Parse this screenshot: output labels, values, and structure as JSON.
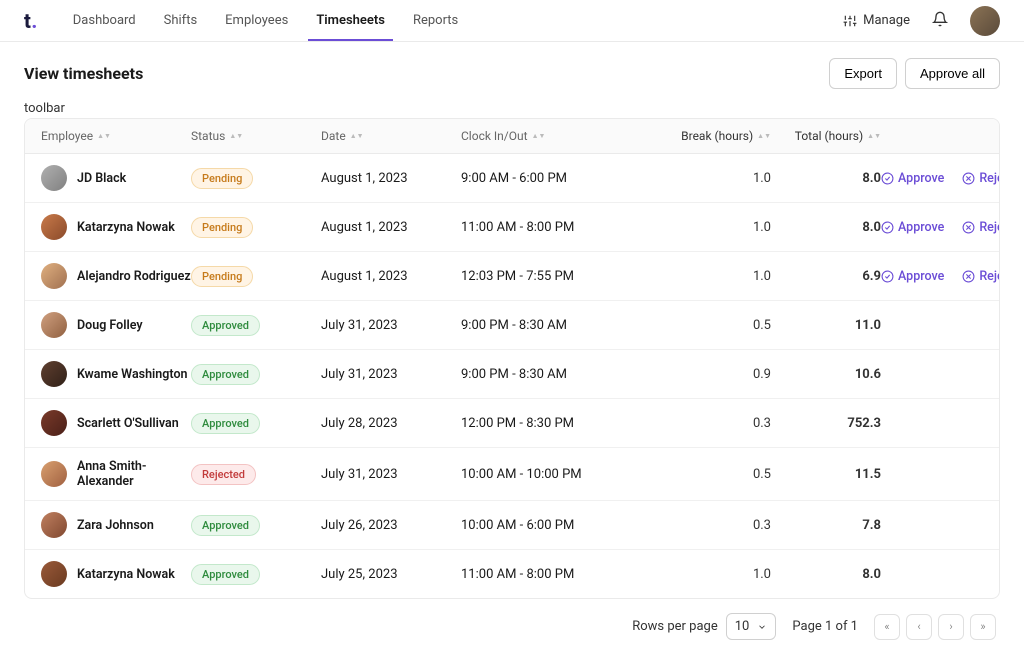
{
  "brand": "t",
  "nav": {
    "items": [
      "Dashboard",
      "Shifts",
      "Employees",
      "Timesheets",
      "Reports"
    ],
    "active": "Timesheets"
  },
  "topbar": {
    "manage": "Manage"
  },
  "page": {
    "title": "View timesheets",
    "export": "Export",
    "approve_all": "Approve all",
    "toolbar": "toolbar"
  },
  "columns": {
    "employee": "Employee",
    "status": "Status",
    "date": "Date",
    "clock": "Clock In/Out",
    "break": "Break (hours)",
    "total": "Total (hours)"
  },
  "status_labels": {
    "pending": "Pending",
    "approved": "Approved",
    "rejected": "Rejected"
  },
  "actions": {
    "approve": "Approve",
    "reject": "Reject"
  },
  "rows": [
    {
      "name": "JD Black",
      "status": "pending",
      "date": "August 1, 2023",
      "clock": "9:00 AM - 6:00 PM",
      "break": "1.0",
      "total": "8.0"
    },
    {
      "name": "Katarzyna Nowak",
      "status": "pending",
      "date": "August 1, 2023",
      "clock": "11:00 AM - 8:00 PM",
      "break": "1.0",
      "total": "8.0"
    },
    {
      "name": "Alejandro Rodriguez",
      "status": "pending",
      "date": "August 1, 2023",
      "clock": "12:03 PM - 7:55 PM",
      "break": "1.0",
      "total": "6.9"
    },
    {
      "name": "Doug Folley",
      "status": "approved",
      "date": "July 31, 2023",
      "clock": "9:00 PM - 8:30 AM",
      "break": "0.5",
      "total": "11.0"
    },
    {
      "name": "Kwame Washington",
      "status": "approved",
      "date": "July 31, 2023",
      "clock": "9:00 PM - 8:30 AM",
      "break": "0.9",
      "total": "10.6"
    },
    {
      "name": "Scarlett O'Sullivan",
      "status": "approved",
      "date": "July 28, 2023",
      "clock": "12:00 PM - 8:30 PM",
      "break": "0.3",
      "total": "752.3"
    },
    {
      "name": "Anna Smith-Alexander",
      "status": "rejected",
      "date": "July 31, 2023",
      "clock": "10:00 AM - 10:00 PM",
      "break": "0.5",
      "total": "11.5"
    },
    {
      "name": "Zara Johnson",
      "status": "approved",
      "date": "July 26, 2023",
      "clock": "10:00 AM - 6:00 PM",
      "break": "0.3",
      "total": "7.8"
    },
    {
      "name": "Katarzyna Nowak",
      "status": "approved",
      "date": "July 25, 2023",
      "clock": "11:00 AM - 8:00 PM",
      "break": "1.0",
      "total": "8.0"
    }
  ],
  "pagination": {
    "rows_per_page_label": "Rows per page",
    "rows_per_page": "10",
    "page_info": "Page 1 of 1"
  }
}
